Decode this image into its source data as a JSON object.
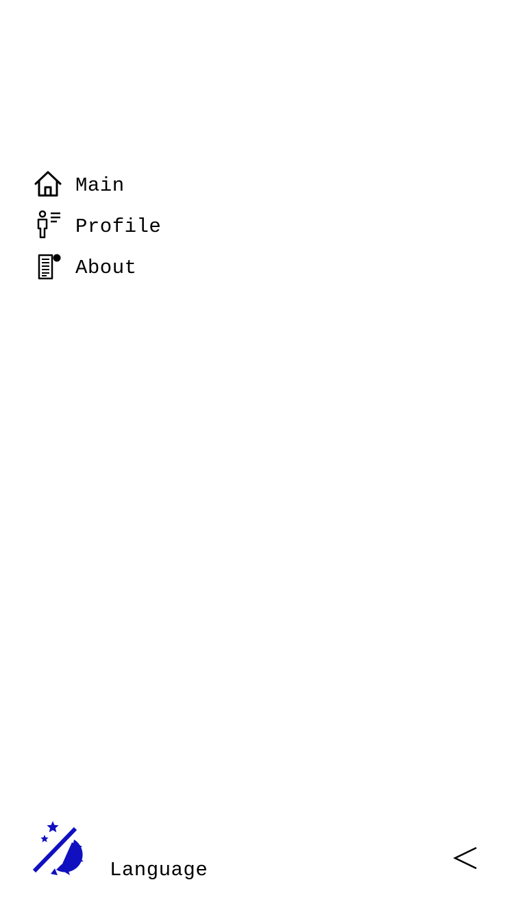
{
  "menu": {
    "items": [
      {
        "label": "Main",
        "icon": "home-icon"
      },
      {
        "label": "Profile",
        "icon": "profile-list-icon"
      },
      {
        "label": "About",
        "icon": "document-notification-icon"
      }
    ]
  },
  "footer": {
    "theme_icon": "day-night-toggle-icon",
    "language_label": "Language",
    "back_icon": "chevron-left-icon"
  },
  "colors": {
    "text": "#000000",
    "accent": "#1010c0",
    "background": "#ffffff"
  }
}
